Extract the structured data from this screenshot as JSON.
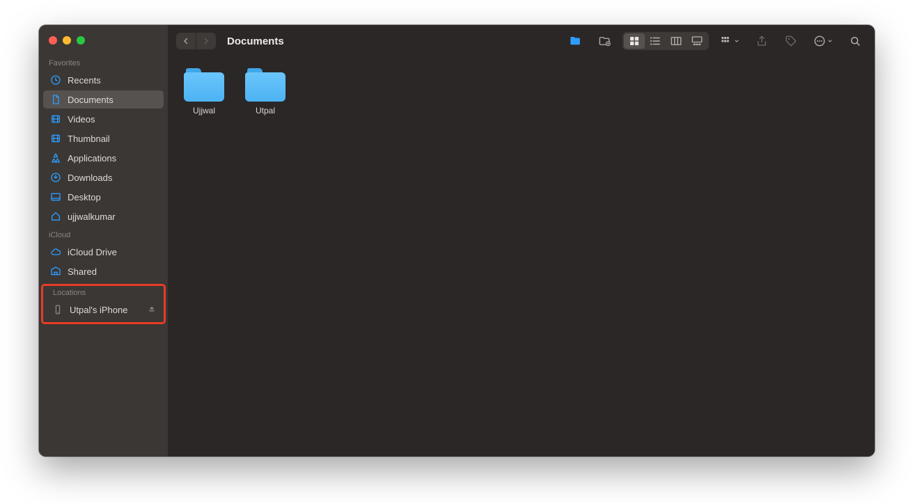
{
  "window_title": "Documents",
  "sidebar": {
    "sections": [
      {
        "label": "Favorites",
        "items": [
          {
            "icon": "clock",
            "label": "Recents"
          },
          {
            "icon": "doc",
            "label": "Documents",
            "selected": true
          },
          {
            "icon": "film",
            "label": "Videos"
          },
          {
            "icon": "film",
            "label": "Thumbnail"
          },
          {
            "icon": "apps",
            "label": "Applications"
          },
          {
            "icon": "download",
            "label": "Downloads"
          },
          {
            "icon": "desktop",
            "label": "Desktop"
          },
          {
            "icon": "home",
            "label": "ujjwalkumar"
          }
        ]
      },
      {
        "label": "iCloud",
        "items": [
          {
            "icon": "cloud",
            "label": "iCloud Drive"
          },
          {
            "icon": "shared",
            "label": "Shared"
          }
        ]
      },
      {
        "label": "Locations",
        "highlight": true,
        "items": [
          {
            "icon": "iphone",
            "label": "Utpal's iPhone",
            "eject": true
          }
        ]
      }
    ]
  },
  "folders": [
    {
      "name": "Ujjwal"
    },
    {
      "name": "Utpal"
    }
  ],
  "colors": {
    "accent": "#2e9dff",
    "highlight_border": "#e83c25"
  }
}
